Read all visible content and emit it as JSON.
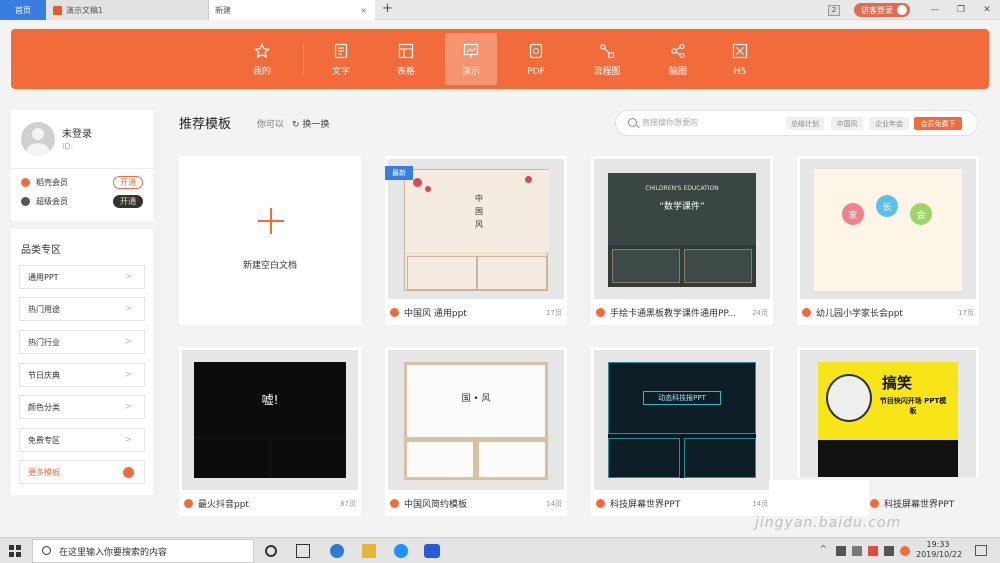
{
  "tabs": {
    "home": "首页",
    "doc": "演示文稿1",
    "new": "新建",
    "close": "×",
    "add": "+"
  },
  "window": {
    "badge": "2",
    "guest_login": "访客登录"
  },
  "apptabs": [
    "我的",
    "文字",
    "表格",
    "演示",
    "PDF",
    "流程图",
    "脑图",
    "H5"
  ],
  "user": {
    "name": "未登录",
    "id_label": "ID:"
  },
  "members": [
    {
      "name": "稻壳会员",
      "button": "开通"
    },
    {
      "name": "超级会员",
      "button": "开通"
    }
  ],
  "categories": {
    "title": "品类专区",
    "items": [
      "通用PPT",
      "热门用途",
      "热门行业",
      "节日庆典",
      "颜色分类",
      "免费专区"
    ],
    "more": "更多模板"
  },
  "main": {
    "title": "推荐模板",
    "may_like": "你可以",
    "refresh": "换一换"
  },
  "search": {
    "placeholder": "直接搜你想要的",
    "chips": [
      "总结计划",
      "中国风",
      "企业年会"
    ],
    "vip": "会员免费下"
  },
  "blank_label": "新建空白文档",
  "cards": [
    {
      "title": "中国风 通用ppt",
      "pages": "17页",
      "badge": "最新",
      "slide": {
        "v": "中国风"
      }
    },
    {
      "title": "手绘卡通黑板教学课件通用PP...",
      "pages": "24页",
      "slide": {
        "title": "“数学课件”",
        "sub": "CHILDREN'S EDUCATION"
      }
    },
    {
      "title": "幼儿园小学家长会ppt",
      "pages": "17页",
      "slide": {
        "chars": [
          "家",
          "长",
          "会"
        ]
      }
    },
    {
      "title": "最火抖音ppt",
      "pages": "87页",
      "slide": {
        "title": "嘘!"
      }
    },
    {
      "title": "中国风简约模板",
      "pages": "14页",
      "slide": {
        "title": "国 • 风"
      }
    },
    {
      "title": "科技屏幕世界PPT",
      "pages": "14页",
      "slide": {
        "title": "动态科技报PPT"
      }
    },
    {
      "title": "",
      "pages": "",
      "slide": {
        "title": "搞笑",
        "sub": "节目快闪开场 PPT模板"
      }
    }
  ],
  "overlay_footer": "科技屏幕世界PPT",
  "watermark": "jingyan.baidu.com",
  "taskbar": {
    "search_placeholder": "在这里输入你要搜索的内容",
    "time": "19:33",
    "date": "2019/10/22"
  },
  "colors": {
    "accent": "#f26b3a",
    "home_tab": "#3a7de0"
  }
}
